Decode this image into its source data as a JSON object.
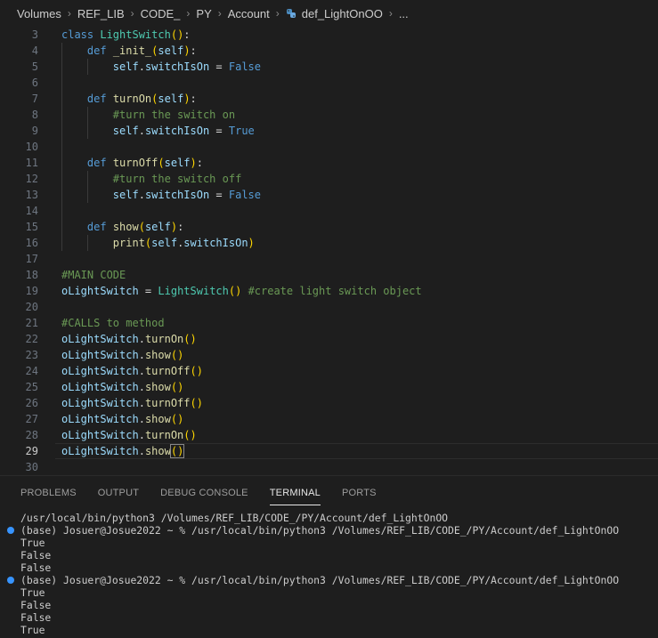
{
  "breadcrumb": {
    "items": [
      "Volumes",
      "REF_LIB",
      "CODE_",
      "PY",
      "Account",
      "def_LightOnOO",
      "..."
    ]
  },
  "editor": {
    "active_line": 29,
    "lines": [
      {
        "n": "3",
        "tokens": [
          [
            "kw",
            "class "
          ],
          [
            "cls",
            "LightSwitch"
          ],
          [
            "p1",
            "()"
          ],
          [
            "op",
            ":"
          ]
        ]
      },
      {
        "n": "4",
        "tokens": [
          [
            "op",
            "    "
          ],
          [
            "kw",
            "def "
          ],
          [
            "fn",
            "_init_"
          ],
          [
            "p1",
            "("
          ],
          [
            "self",
            "self"
          ],
          [
            "p1",
            ")"
          ],
          [
            "op",
            ":"
          ]
        ]
      },
      {
        "n": "5",
        "tokens": [
          [
            "op",
            "        "
          ],
          [
            "self",
            "self"
          ],
          [
            "dot",
            "."
          ],
          [
            "var",
            "switchIsOn"
          ],
          [
            "op",
            " = "
          ],
          [
            "const",
            "False"
          ]
        ]
      },
      {
        "n": "6",
        "tokens": []
      },
      {
        "n": "7",
        "tokens": [
          [
            "op",
            "    "
          ],
          [
            "kw",
            "def "
          ],
          [
            "fn",
            "turnOn"
          ],
          [
            "p1",
            "("
          ],
          [
            "self",
            "self"
          ],
          [
            "p1",
            ")"
          ],
          [
            "op",
            ":"
          ]
        ]
      },
      {
        "n": "8",
        "tokens": [
          [
            "op",
            "        "
          ],
          [
            "cm",
            "#turn the switch on"
          ]
        ]
      },
      {
        "n": "9",
        "tokens": [
          [
            "op",
            "        "
          ],
          [
            "self",
            "self"
          ],
          [
            "dot",
            "."
          ],
          [
            "var",
            "switchIsOn"
          ],
          [
            "op",
            " = "
          ],
          [
            "const",
            "True"
          ]
        ]
      },
      {
        "n": "10",
        "tokens": []
      },
      {
        "n": "11",
        "tokens": [
          [
            "op",
            "    "
          ],
          [
            "kw",
            "def "
          ],
          [
            "fn",
            "turnOff"
          ],
          [
            "p1",
            "("
          ],
          [
            "self",
            "self"
          ],
          [
            "p1",
            ")"
          ],
          [
            "op",
            ":"
          ]
        ]
      },
      {
        "n": "12",
        "tokens": [
          [
            "op",
            "        "
          ],
          [
            "cm",
            "#turn the switch off"
          ]
        ]
      },
      {
        "n": "13",
        "tokens": [
          [
            "op",
            "        "
          ],
          [
            "self",
            "self"
          ],
          [
            "dot",
            "."
          ],
          [
            "var",
            "switchIsOn"
          ],
          [
            "op",
            " = "
          ],
          [
            "const",
            "False"
          ]
        ]
      },
      {
        "n": "14",
        "tokens": []
      },
      {
        "n": "15",
        "tokens": [
          [
            "op",
            "    "
          ],
          [
            "kw",
            "def "
          ],
          [
            "fn",
            "show"
          ],
          [
            "p1",
            "("
          ],
          [
            "self",
            "self"
          ],
          [
            "p1",
            ")"
          ],
          [
            "op",
            ":"
          ]
        ]
      },
      {
        "n": "16",
        "tokens": [
          [
            "op",
            "        "
          ],
          [
            "fn",
            "print"
          ],
          [
            "p1",
            "("
          ],
          [
            "self",
            "self"
          ],
          [
            "dot",
            "."
          ],
          [
            "var",
            "switchIsOn"
          ],
          [
            "p1",
            ")"
          ]
        ]
      },
      {
        "n": "17",
        "tokens": []
      },
      {
        "n": "18",
        "tokens": [
          [
            "cm",
            "#MAIN CODE"
          ]
        ]
      },
      {
        "n": "19",
        "tokens": [
          [
            "var",
            "oLightSwitch"
          ],
          [
            "op",
            " = "
          ],
          [
            "cls",
            "LightSwitch"
          ],
          [
            "p1",
            "()"
          ],
          [
            "op",
            " "
          ],
          [
            "cm",
            "#create light switch object"
          ]
        ]
      },
      {
        "n": "20",
        "tokens": []
      },
      {
        "n": "21",
        "tokens": [
          [
            "cm",
            "#CALLS to method"
          ]
        ]
      },
      {
        "n": "22",
        "tokens": [
          [
            "var",
            "oLightSwitch"
          ],
          [
            "dot",
            "."
          ],
          [
            "fn",
            "turnOn"
          ],
          [
            "p1",
            "()"
          ]
        ]
      },
      {
        "n": "23",
        "tokens": [
          [
            "var",
            "oLightSwitch"
          ],
          [
            "dot",
            "."
          ],
          [
            "fn",
            "show"
          ],
          [
            "p1",
            "()"
          ]
        ]
      },
      {
        "n": "24",
        "tokens": [
          [
            "var",
            "oLightSwitch"
          ],
          [
            "dot",
            "."
          ],
          [
            "fn",
            "turnOff"
          ],
          [
            "p1",
            "()"
          ]
        ]
      },
      {
        "n": "25",
        "tokens": [
          [
            "var",
            "oLightSwitch"
          ],
          [
            "dot",
            "."
          ],
          [
            "fn",
            "show"
          ],
          [
            "p1",
            "()"
          ]
        ]
      },
      {
        "n": "26",
        "tokens": [
          [
            "var",
            "oLightSwitch"
          ],
          [
            "dot",
            "."
          ],
          [
            "fn",
            "turnOff"
          ],
          [
            "p1",
            "()"
          ]
        ]
      },
      {
        "n": "27",
        "tokens": [
          [
            "var",
            "oLightSwitch"
          ],
          [
            "dot",
            "."
          ],
          [
            "fn",
            "show"
          ],
          [
            "p1",
            "()"
          ]
        ]
      },
      {
        "n": "28",
        "tokens": [
          [
            "var",
            "oLightSwitch"
          ],
          [
            "dot",
            "."
          ],
          [
            "fn",
            "turnOn"
          ],
          [
            "p1",
            "()"
          ]
        ]
      },
      {
        "n": "29",
        "tokens": [
          [
            "var",
            "oLightSwitch"
          ],
          [
            "dot",
            "."
          ],
          [
            "fn",
            "show"
          ],
          [
            "p1",
            "()"
          ]
        ]
      },
      {
        "n": "30",
        "tokens": []
      }
    ]
  },
  "panel": {
    "tabs": [
      {
        "label": "PROBLEMS",
        "active": false
      },
      {
        "label": "OUTPUT",
        "active": false
      },
      {
        "label": "DEBUG CONSOLE",
        "active": false
      },
      {
        "label": "TERMINAL",
        "active": true
      },
      {
        "label": "PORTS",
        "active": false
      }
    ]
  },
  "terminal": {
    "lines": [
      {
        "text": "/usr/local/bin/python3 /Volumes/REF_LIB/CODE_/PY/Account/def_LightOnOO",
        "mark": false
      },
      {
        "text": "(base) Josuer@Josue2022 ~ % /usr/local/bin/python3 /Volumes/REF_LIB/CODE_/PY/Account/def_LightOnOO",
        "mark": true
      },
      {
        "text": "True",
        "mark": false
      },
      {
        "text": "False",
        "mark": false
      },
      {
        "text": "False",
        "mark": false
      },
      {
        "text": "(base) Josuer@Josue2022 ~ % /usr/local/bin/python3 /Volumes/REF_LIB/CODE_/PY/Account/def_LightOnOO",
        "mark": true
      },
      {
        "text": "True",
        "mark": false
      },
      {
        "text": "False",
        "mark": false
      },
      {
        "text": "False",
        "mark": false
      },
      {
        "text": "True",
        "mark": false
      }
    ]
  },
  "colors": {
    "background": "#1e1e1e",
    "keyword": "#569cd6",
    "class": "#4ec9b0",
    "function": "#dcdcaa",
    "variable": "#9cdcfe",
    "comment": "#6a9955",
    "bracket": "#ffd700",
    "terminal_mark": "#3794ff"
  }
}
